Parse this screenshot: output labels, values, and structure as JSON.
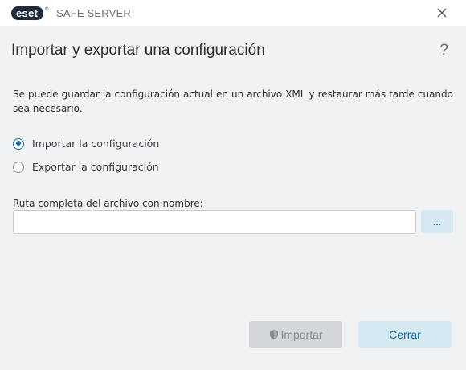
{
  "window": {
    "brand": "eset",
    "product": "SAFE SERVER"
  },
  "dialog": {
    "title": "Importar y exportar una configuración",
    "help_symbol": "?",
    "description": "Se puede guardar la configuración actual en un archivo XML y restaurar más tarde cuando sea necesario.",
    "options": [
      {
        "label": "Importar la configuración",
        "checked": true
      },
      {
        "label": "Exportar la configuración",
        "checked": false
      }
    ],
    "path": {
      "label": "Ruta completa del archivo con nombre:",
      "value": "",
      "browse_label": "..."
    },
    "buttons": {
      "import_label": "Importar",
      "close_label": "Cerrar"
    }
  },
  "colors": {
    "accent": "#0d6f9e",
    "button_secondary_bg": "#d6e8f2",
    "disabled_bg": "#d4d7da"
  }
}
